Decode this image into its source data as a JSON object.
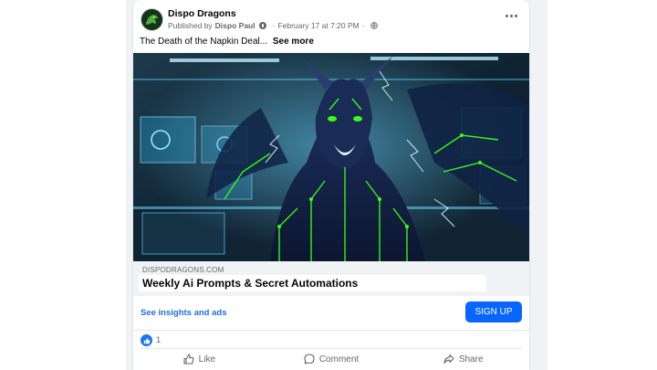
{
  "post": {
    "page_name": "Dispo Dragons",
    "published_by_label": "Published by",
    "publisher": "Dispo Paul",
    "date": "February 17 at 7:20 PM",
    "caption": "The Death of the Napkin Deal...",
    "see_more": "See more"
  },
  "link_card": {
    "domain": "DISPODRAGONS.COM",
    "title": "Weekly Ai Prompts & Secret Automations"
  },
  "ad": {
    "insights_link": "See insights and ads",
    "cta_label": "SIGN UP"
  },
  "reactions": {
    "count": "1"
  },
  "actions": {
    "like": "Like",
    "comment": "Comment",
    "share": "Share"
  },
  "icons": {
    "avatar": "dragon-avatar",
    "more": "ellipsis-icon",
    "audience": "globe-icon",
    "info": "info-icon",
    "reaction": "thumbs-up-icon",
    "like": "thumbs-up-outline-icon",
    "comment": "speech-bubble-icon",
    "share": "share-arrow-icon"
  },
  "colors": {
    "brand_blue": "#0866ff",
    "link_blue": "#216fdb",
    "text_secondary": "#65676b",
    "neon_green": "#39ff14"
  }
}
